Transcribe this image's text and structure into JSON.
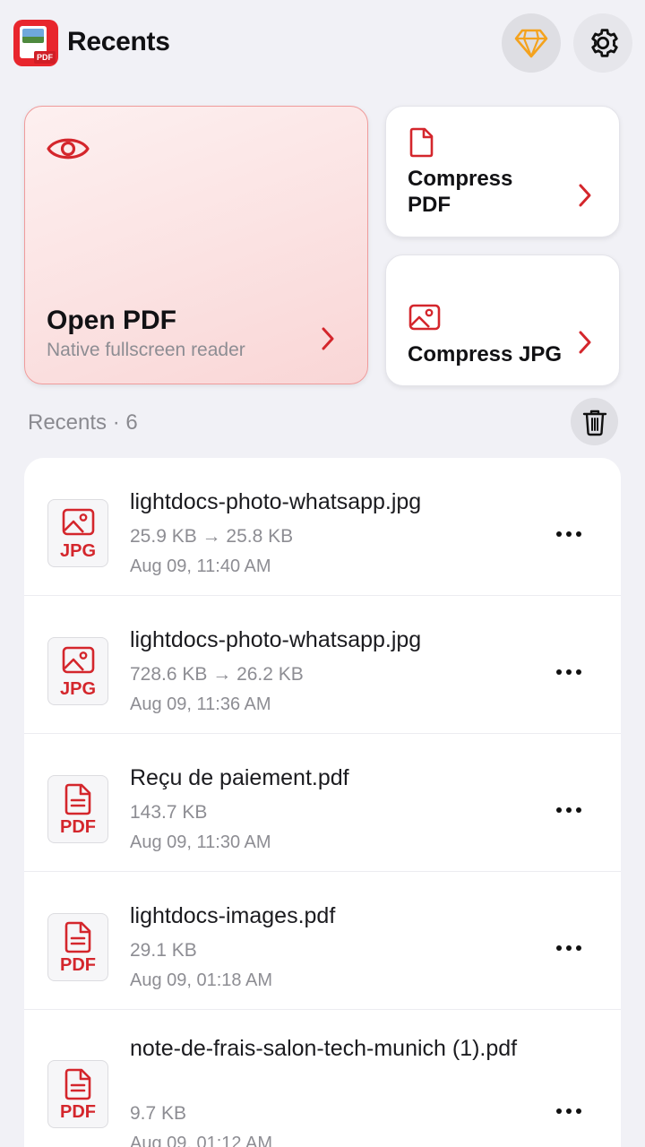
{
  "header": {
    "title": "Recents",
    "logo_badge": "PDF"
  },
  "actions": {
    "open_pdf": {
      "title": "Open PDF",
      "subtitle": "Native fullscreen reader"
    },
    "compress_pdf": {
      "label": "Compress PDF"
    },
    "compress_jpg": {
      "label": "Compress JPG"
    }
  },
  "recents": {
    "label": "Recents · 6",
    "files": [
      {
        "name": "lightdocs-photo-whatsapp.jpg",
        "size": "25.9 KB → 25.8 KB",
        "date": "Aug 09, 11:40 AM",
        "type": "JPG"
      },
      {
        "name": "lightdocs-photo-whatsapp.jpg",
        "size": "728.6 KB → 26.2 KB",
        "date": "Aug 09, 11:36 AM",
        "type": "JPG"
      },
      {
        "name": "Reçu de paiement.pdf",
        "size": "143.7 KB",
        "date": "Aug 09, 11:30 AM",
        "type": "PDF"
      },
      {
        "name": "lightdocs-images.pdf",
        "size": "29.1 KB",
        "date": "Aug 09, 01:18 AM",
        "type": "PDF"
      },
      {
        "name": "note-de-frais-salon-tech-munich (1).pdf",
        "size": "9.7 KB",
        "date": "Aug 09, 01:12 AM",
        "type": "PDF"
      }
    ]
  },
  "colors": {
    "accent": "#d4262c",
    "premium": "#f4a21d",
    "background": "#f1f1f6"
  }
}
